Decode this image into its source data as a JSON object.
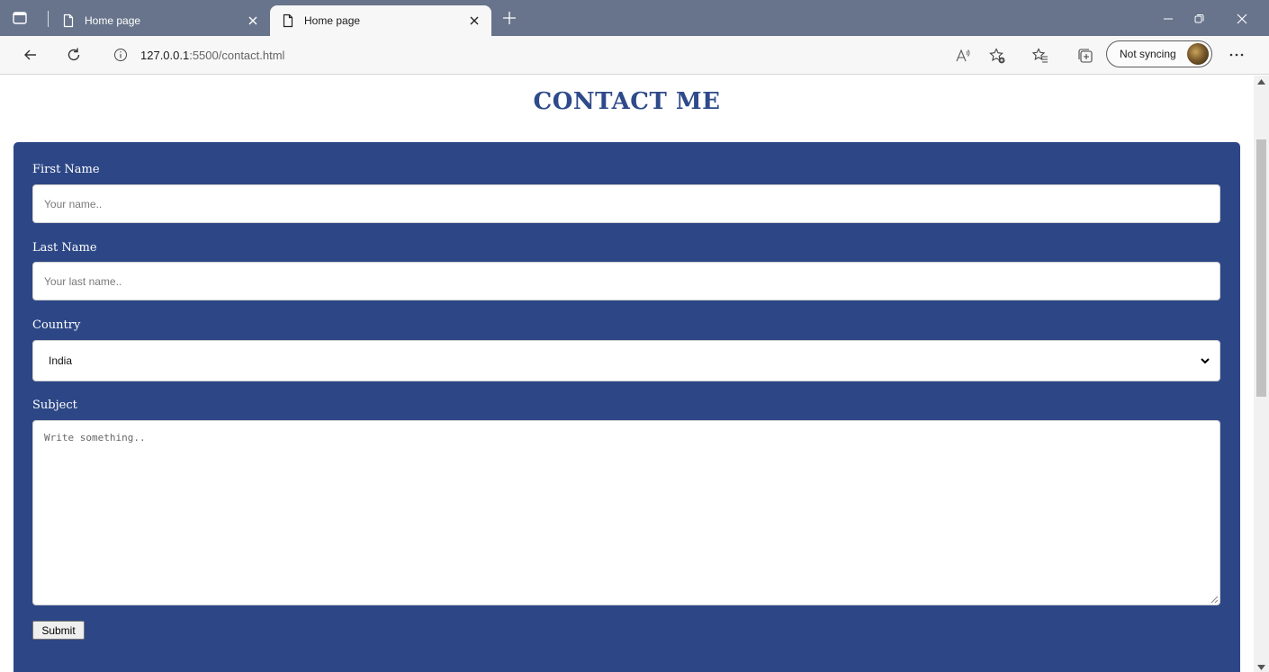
{
  "browser": {
    "tabs": [
      {
        "title": "Home page",
        "active": false
      },
      {
        "title": "Home page",
        "active": true
      }
    ],
    "url": {
      "host": "127.0.0.1",
      "path": ":5500/contact.html"
    },
    "sync_label": "Not syncing",
    "icons": [
      "tab-actions-icon",
      "page-icon",
      "close-icon",
      "plus-icon",
      "minimize-icon",
      "restore-icon",
      "back-icon",
      "refresh-icon",
      "info-icon",
      "read-aloud-icon",
      "add-favorite-icon",
      "favorites-icon",
      "collections-icon",
      "more-icon"
    ]
  },
  "page": {
    "title": "CONTACT ME",
    "form": {
      "first_name": {
        "label": "First Name",
        "placeholder": "Your name.."
      },
      "last_name": {
        "label": "Last Name",
        "placeholder": "Your last name.."
      },
      "country": {
        "label": "Country",
        "value": "India"
      },
      "subject": {
        "label": "Subject",
        "placeholder": "Write something.."
      },
      "submit_label": "Submit"
    }
  },
  "colors": {
    "tabbar": "#67748b",
    "panel": "#2d4786",
    "title": "#2e4a8a"
  }
}
